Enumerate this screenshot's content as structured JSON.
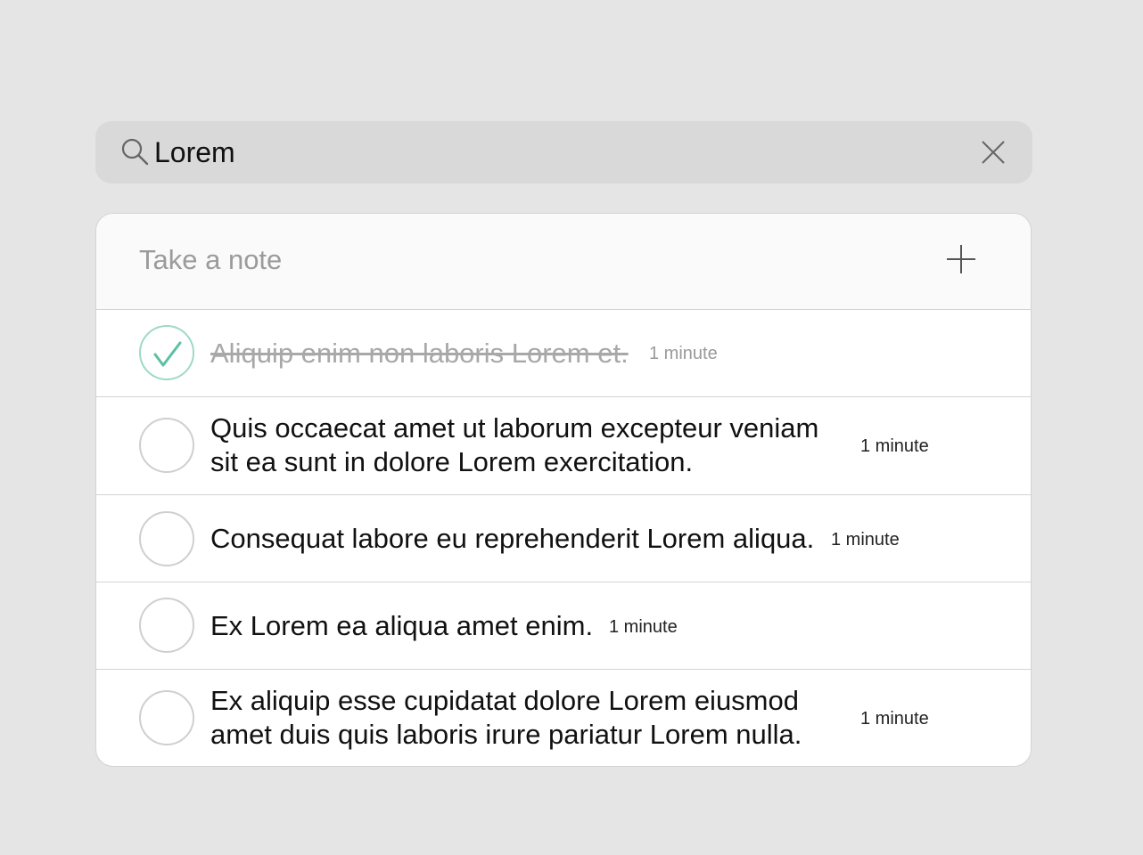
{
  "search": {
    "value": "Lorem",
    "clear_icon": "close-icon",
    "search_icon": "search-icon"
  },
  "composer": {
    "placeholder": "Take a note",
    "add_icon": "plus-icon"
  },
  "notes": [
    {
      "text": "Aliquip enim non laboris Lorem et.",
      "time": "1 minute",
      "done": true
    },
    {
      "text_line1": "Quis occaecat amet ut laborum excepteur veniam",
      "text_line2": "sit ea sunt in dolore Lorem exercitation.",
      "time": "1 minute",
      "done": false
    },
    {
      "text": "Consequat labore eu reprehenderit Lorem aliqua.",
      "time": "1 minute",
      "done": false
    },
    {
      "text": "Ex Lorem ea aliqua amet enim.",
      "time": "1 minute",
      "done": false
    },
    {
      "text_line1": "Ex aliquip esse cupidatat dolore Lorem eiusmod",
      "text_line2": "amet duis quis laboris irure pariatur Lorem nulla.",
      "time": "1 minute",
      "done": false
    }
  ],
  "colors": {
    "background": "#e5e5e5",
    "search_bg": "#d9d9d9",
    "check_accent": "#5dbfa5",
    "done_text": "#a8a8a8"
  }
}
